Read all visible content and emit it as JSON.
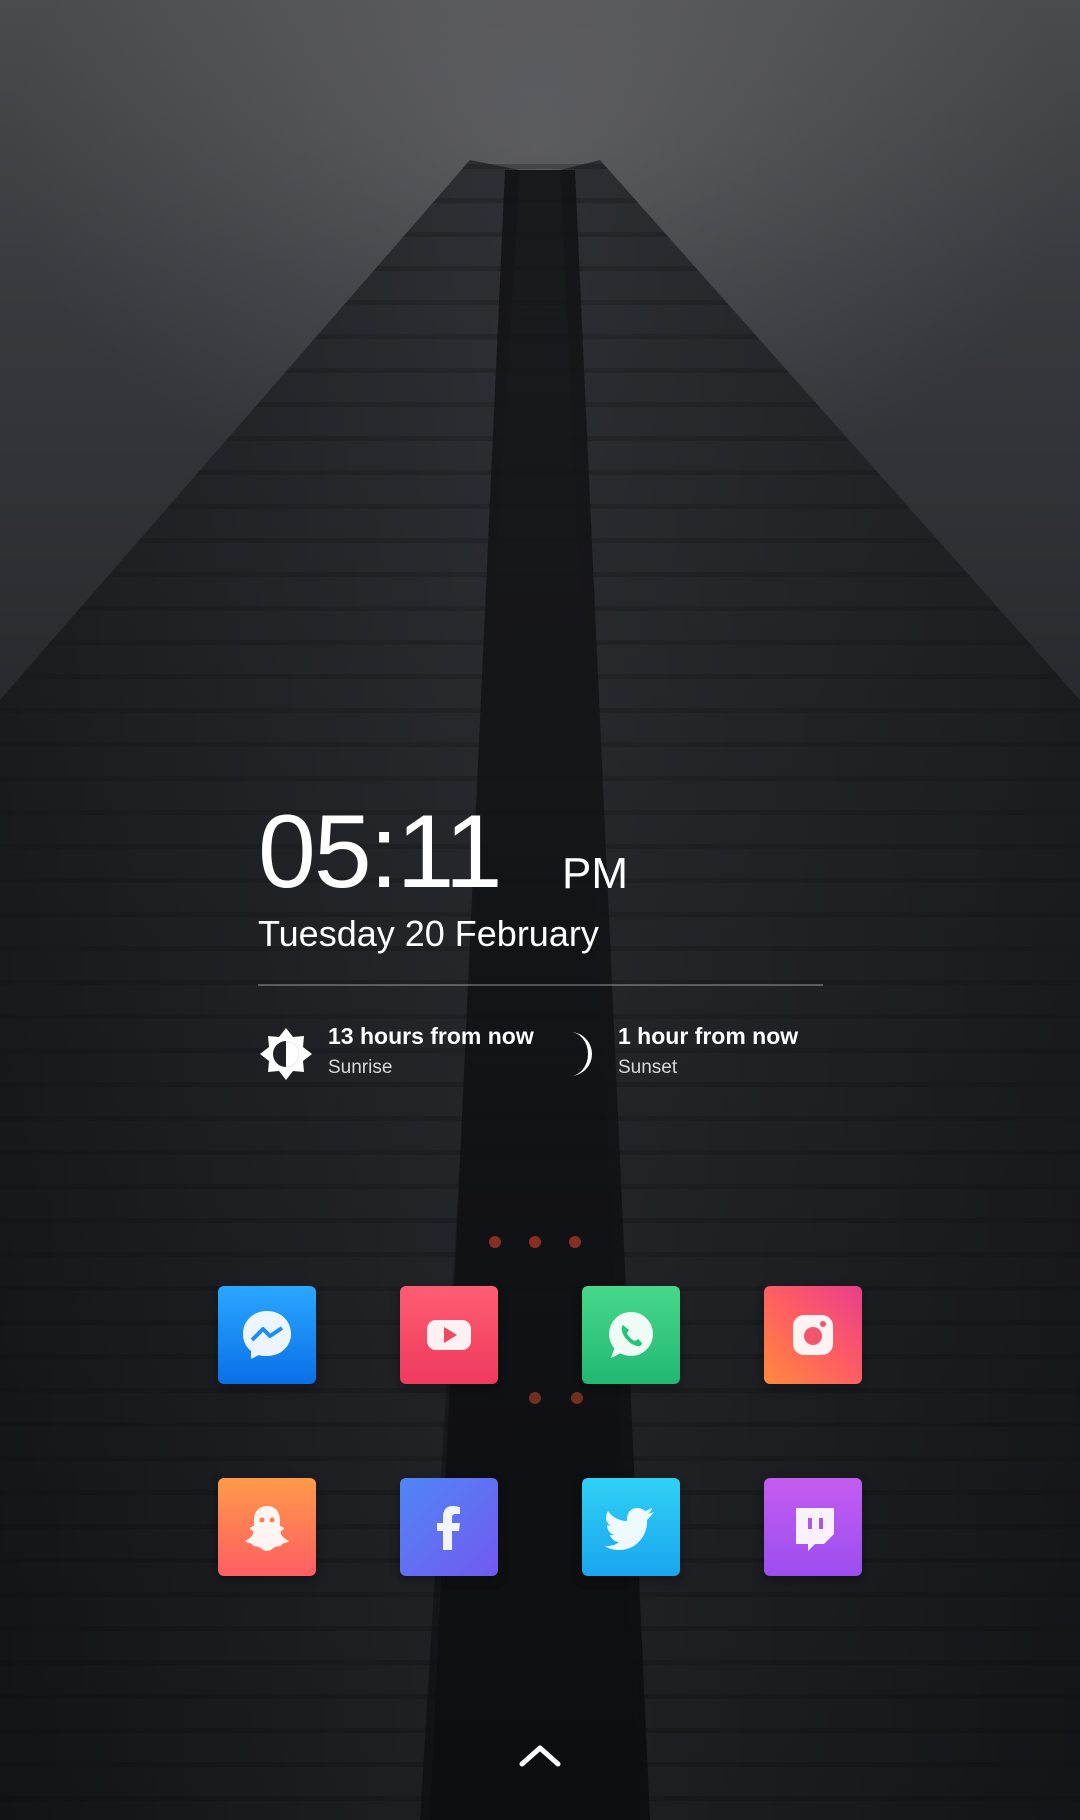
{
  "clock": {
    "time": "05:11",
    "ampm": "PM",
    "date": "Tuesday 20 February"
  },
  "sun_widget": {
    "sunrise": {
      "title": "13 hours from now",
      "label": "Sunrise",
      "icon": "brightness-icon"
    },
    "sunset": {
      "title": "1 hour from now",
      "label": "Sunset",
      "icon": "moon-icon"
    }
  },
  "apps": [
    {
      "name": "messenger",
      "icon": "messenger-icon",
      "colors": [
        "#2aa8ff",
        "#0a6fe8"
      ]
    },
    {
      "name": "youtube",
      "icon": "youtube-icon",
      "colors": [
        "#ff5d73",
        "#ef3a5d"
      ]
    },
    {
      "name": "whatsapp",
      "icon": "whatsapp-icon",
      "colors": [
        "#47d98a",
        "#22b873"
      ]
    },
    {
      "name": "instagram",
      "icon": "instagram-icon",
      "colors": [
        "#ff8a3d",
        "#e83e8c"
      ]
    },
    {
      "name": "snapchat",
      "icon": "ghost-icon",
      "colors": [
        "#ff9a4a",
        "#ff5e62"
      ]
    },
    {
      "name": "facebook",
      "icon": "facebook-icon",
      "colors": [
        "#5b7cf5",
        "#6a5ef0"
      ]
    },
    {
      "name": "twitter",
      "icon": "twitter-bird-icon",
      "colors": [
        "#2fd1f5",
        "#1aa6ee"
      ]
    },
    {
      "name": "twitch",
      "icon": "twitch-icon",
      "colors": [
        "#c45cf0",
        "#9b4ef0"
      ]
    }
  ],
  "app_drawer": {
    "icon": "chevron-up-icon"
  }
}
